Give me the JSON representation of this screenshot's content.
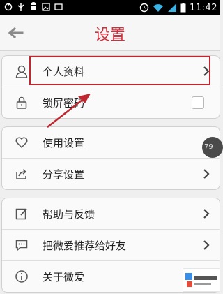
{
  "status_bar": {
    "time": "11:42"
  },
  "header": {
    "title": "设置"
  },
  "groups": [
    {
      "items": [
        {
          "label": "个人资料",
          "icon": "person-icon",
          "control": "chevron"
        },
        {
          "label": "锁屏密码",
          "icon": "lock-icon",
          "control": "checkbox"
        }
      ]
    },
    {
      "items": [
        {
          "label": "使用设置",
          "icon": "heart-icon",
          "control": "none"
        },
        {
          "label": "分享设置",
          "icon": "share-icon",
          "control": "chevron"
        }
      ]
    },
    {
      "items": [
        {
          "label": "帮助与反馈",
          "icon": "edit-icon",
          "control": "chevron"
        },
        {
          "label": "把微爱推荐给好友",
          "icon": "chat-bubble-icon",
          "control": "chevron"
        },
        {
          "label": "关于微爱",
          "icon": "info-icon",
          "control": "none"
        }
      ]
    }
  ],
  "floating_badge": {
    "text": "79"
  },
  "colors": {
    "accent": "#d0303c",
    "annotation": "#c0262f"
  }
}
